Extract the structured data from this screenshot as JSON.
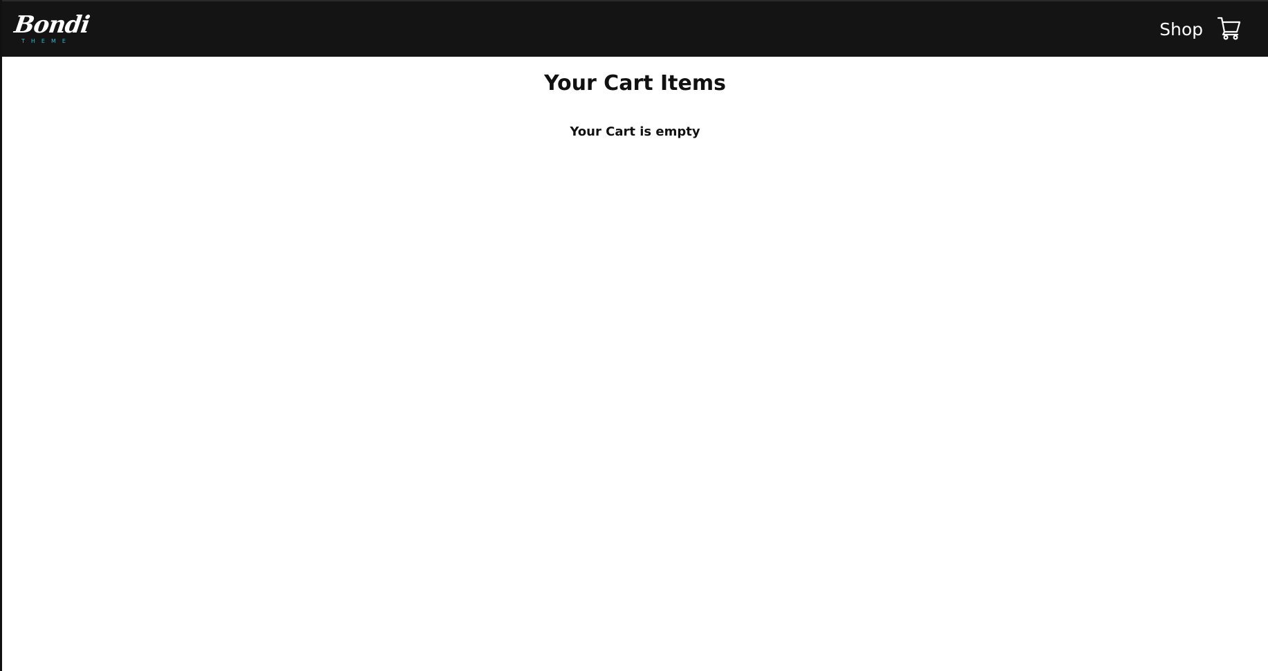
{
  "header": {
    "logo": {
      "script": "Bondi",
      "subtitle": "THEME",
      "subtitle_color": "#19c3d8"
    },
    "nav": {
      "shop_label": "Shop"
    },
    "cart_icon": "cart-icon",
    "background": "#141414"
  },
  "main": {
    "title": "Your Cart Items",
    "empty_message": "Your Cart is empty"
  }
}
